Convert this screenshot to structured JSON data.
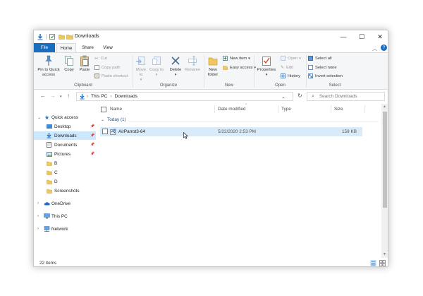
{
  "window": {
    "title": "Downloads",
    "minimize": "—",
    "maximize": "☐",
    "close": "✕"
  },
  "tabs": [
    {
      "label": "File"
    },
    {
      "label": "Home"
    },
    {
      "label": "Share"
    },
    {
      "label": "View"
    }
  ],
  "ribbon": {
    "clipboard": {
      "label": "Clipboard",
      "pin_quick_access": "Pin to Quick access",
      "copy": "Copy",
      "paste": "Paste",
      "cut": "Cut",
      "copy_path": "Copy path",
      "paste_shortcut": "Paste shortcut"
    },
    "organize": {
      "label": "Organize",
      "move_to": "Move to",
      "copy_to": "Copy to",
      "delete": "Delete",
      "rename": "Rename"
    },
    "new": {
      "label": "New",
      "new_folder": "New folder",
      "new_item": "New item",
      "easy_access": "Easy access"
    },
    "open": {
      "label": "Open",
      "properties": "Properties",
      "open": "Open",
      "edit": "Edit",
      "history": "History"
    },
    "select": {
      "label": "Select",
      "select_all": "Select all",
      "select_none": "Select none",
      "invert_selection": "Invert selection"
    }
  },
  "address": {
    "segments": [
      "This PC",
      "Downloads"
    ],
    "search_placeholder": "Search Downloads"
  },
  "navpane": {
    "quick_access": "Quick access",
    "items": [
      "Desktop",
      "Downloads",
      "Documents",
      "Pictures",
      "B",
      "C",
      "D",
      "Screenshots"
    ],
    "onedrive": "OneDrive",
    "this_pc": "This PC",
    "network": "Network"
  },
  "columns": {
    "name": "Name",
    "date_modified": "Date modified",
    "type": "Type",
    "size": "Size"
  },
  "group": {
    "label": "Today (1)"
  },
  "files": [
    {
      "name": "AirParrot3-64",
      "date": "5/22/2020 2:53 PM",
      "type": "",
      "size": "158 KB"
    }
  ],
  "status": {
    "count": "22 items"
  },
  "colors": {
    "accent": "#1a6ebf",
    "selection": "#cce8ff",
    "row_hover": "#d9ebf9",
    "folder": "#f0c75e"
  }
}
